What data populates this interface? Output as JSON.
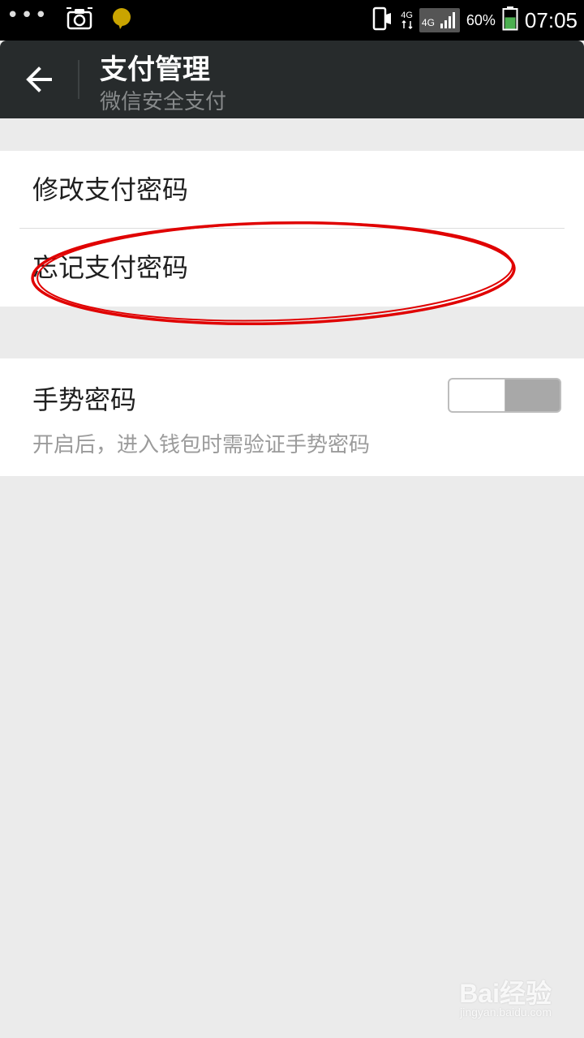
{
  "status_bar": {
    "network_top": "4G",
    "network_badge": "4G",
    "battery_percent": "60%",
    "battery_level": 0.6,
    "time": "07:05",
    "colors": {
      "notification_bubble": "#c9a400",
      "battery_fill": "#4caf50"
    }
  },
  "header": {
    "title": "支付管理",
    "subtitle": "微信安全支付"
  },
  "settings": {
    "change_password_label": "修改支付密码",
    "forgot_password_label": "忘记支付密码",
    "gesture_password_label": "手势密码",
    "gesture_password_desc": "开启后，进入钱包时需验证手势密码",
    "gesture_toggle_on": false
  },
  "annotation": {
    "color": "#e00000"
  },
  "watermark": {
    "brand": "Bai经验",
    "url": "jingyan.baidu.com"
  }
}
